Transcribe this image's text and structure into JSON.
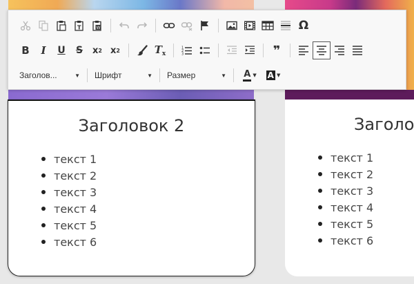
{
  "toolbar": {
    "row1": {
      "cut": "cut-icon",
      "copy": "copy-icon",
      "paste": "paste-icon",
      "paste_text": "paste-text-icon",
      "paste_word": "paste-word-icon",
      "undo": "undo-icon",
      "redo": "redo-icon",
      "link": "link-icon",
      "unlink": "unlink-icon",
      "anchor": "flag-icon",
      "image": "image-icon",
      "video": "video-icon",
      "table": "table-icon",
      "hr": "horizontal-rule-icon",
      "special_char": "Ω"
    },
    "row2": {
      "bold": "B",
      "italic": "I",
      "underline": "U",
      "strike": "S",
      "subscript": "x",
      "subscript_mark": "2",
      "superscript": "x",
      "superscript_mark": "2",
      "format_painter": "brush-icon",
      "clear_format": "T",
      "clear_format_mark": "x",
      "quote": "❞"
    },
    "row3": {
      "format_label": "Заголов...",
      "font_label": "Шрифт",
      "size_label": "Размер",
      "text_color_label": "A",
      "bg_color_label": "A"
    }
  },
  "cards": [
    {
      "title": "Заголовок 2",
      "items": [
        "текст 1",
        "текст 2",
        "текст 3",
        "текст 4",
        "текст 5",
        "текст 6"
      ]
    },
    {
      "title": "Заголо",
      "items": [
        "текст 1",
        "текст 2",
        "текст 3",
        "текст 4",
        "текст 5",
        "текст 6"
      ]
    }
  ],
  "colors": {
    "toolbar_bg": "#f8f8f8",
    "page_bg": "#e8e8e8",
    "card_border": "#222222"
  }
}
